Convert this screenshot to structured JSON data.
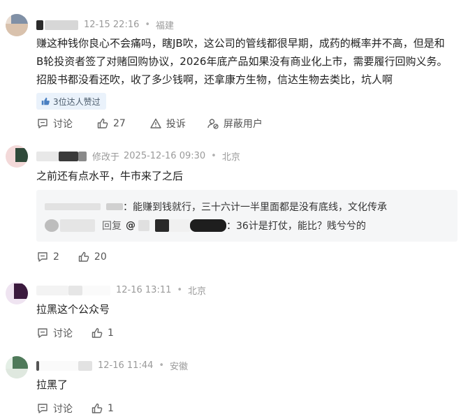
{
  "comments": [
    {
      "time": "12-15 22:16",
      "location": "福建",
      "text": "赚这种钱你良心不会痛吗，瞎JB吹，这公司的管线都很早期，成药的概率并不高，但是和B轮投资者签了对赌回购协议，2026年底产品如果没有商业化上市，需要履行回购义务。招股书都没看还吹，收了多少钱啊，还拿康方生物，信达生物去类比，坑人啊",
      "likes_tag": "3位达人赞过",
      "actions": {
        "discuss": "讨论",
        "likes": "27",
        "report": "投诉",
        "block": "屏蔽用户"
      }
    },
    {
      "modified_prefix": "修改于",
      "time": "2025-12-16 09:30",
      "location": "北京",
      "text": "之前还有点水平，牛市来了之后",
      "replies": [
        {
          "separator": "：",
          "text": "能赚到钱就行，三十六计一半里面都是没有底线，文化传承"
        },
        {
          "reply_label": "回复",
          "at": "@",
          "separator": "：",
          "text": "36计是打仗，能比？贱兮兮的"
        }
      ],
      "actions": {
        "comments": "2",
        "likes": "20"
      }
    },
    {
      "time": "12-16 13:11",
      "location": "北京",
      "text": "拉黑这个公众号",
      "actions": {
        "discuss": "讨论",
        "likes": "1"
      }
    },
    {
      "time": "12-16 11:44",
      "location": "安徽",
      "text": "拉黑了",
      "actions": {
        "discuss": "讨论",
        "likes": "1"
      }
    }
  ],
  "colors": {
    "meta": "#9a9a9a",
    "tag_bg": "#eaf2fb",
    "reply_bg": "#f5f6f7"
  }
}
